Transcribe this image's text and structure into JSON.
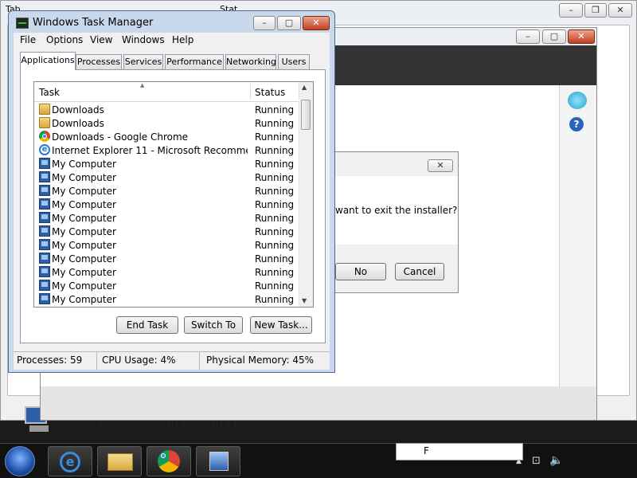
{
  "background_windows": {
    "dialog_message": "want to exit the installer?",
    "no_label": "No",
    "cancel_label": "Cancel",
    "close_glyph": "✕",
    "bottom_text": "Proce... Intel(R) Xeon(R) CP...",
    "corner_text_1": "Tab",
    "corner_text_2": "Stat"
  },
  "task_manager": {
    "title": "Windows Task Manager",
    "menu": [
      "File",
      "Options",
      "View",
      "Windows",
      "Help"
    ],
    "tabs": [
      "Applications",
      "Processes",
      "Services",
      "Performance",
      "Networking",
      "Users"
    ],
    "active_tab": "Applications",
    "columns": {
      "task": "Task",
      "status": "Status"
    },
    "rows": [
      {
        "task": "Downloads",
        "status": "Running",
        "icon": "folder-icon"
      },
      {
        "task": "Downloads",
        "status": "Running",
        "icon": "folder-icon"
      },
      {
        "task": "Downloads - Google Chrome",
        "status": "Running",
        "icon": "chrome-icon"
      },
      {
        "task": "Internet Explorer 11 - Microsoft Recommended ...",
        "status": "Running",
        "icon": "internet-explorer-icon"
      },
      {
        "task": "My Computer",
        "status": "Running",
        "icon": "computer-icon"
      },
      {
        "task": "My Computer",
        "status": "Running",
        "icon": "computer-icon"
      },
      {
        "task": "My Computer",
        "status": "Running",
        "icon": "computer-icon"
      },
      {
        "task": "My Computer",
        "status": "Running",
        "icon": "computer-icon"
      },
      {
        "task": "My Computer",
        "status": "Running",
        "icon": "computer-icon"
      },
      {
        "task": "My Computer",
        "status": "Running",
        "icon": "computer-icon"
      },
      {
        "task": "My Computer",
        "status": "Running",
        "icon": "computer-icon"
      },
      {
        "task": "My Computer",
        "status": "Running",
        "icon": "computer-icon"
      },
      {
        "task": "My Computer",
        "status": "Running",
        "icon": "computer-icon"
      },
      {
        "task": "My Computer",
        "status": "Running",
        "icon": "computer-icon"
      },
      {
        "task": "My Computer",
        "status": "Running",
        "icon": "computer-icon"
      }
    ],
    "buttons": {
      "end_task": "End Task",
      "switch_to": "Switch To",
      "new_task": "New Task..."
    },
    "status_bar": {
      "processes": "Processes: 59",
      "cpu": "CPU Usage: 4%",
      "memory": "Physical Memory: 45%"
    }
  },
  "taskbar": {
    "items": [
      "start-orb-icon",
      "internet-explorer-icon",
      "file-explorer-icon",
      "chrome-icon",
      "setup-icon"
    ],
    "tray_text": "F"
  },
  "colors": {
    "titlebar": "#c9d9ec",
    "close_button": "#c2401f",
    "taskbar": "#111111"
  }
}
